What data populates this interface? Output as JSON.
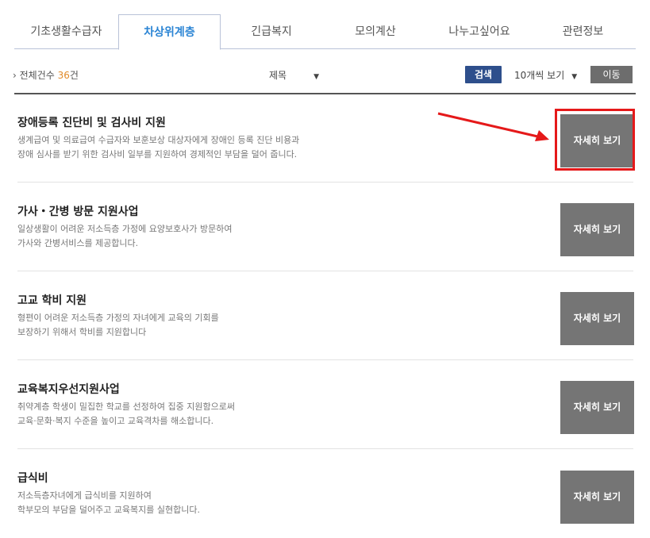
{
  "tabs": [
    {
      "label": "기초생활수급자",
      "active": false
    },
    {
      "label": "차상위계층",
      "active": true
    },
    {
      "label": "긴급복지",
      "active": false
    },
    {
      "label": "모의계산",
      "active": false
    },
    {
      "label": "나누고싶어요",
      "active": false
    },
    {
      "label": "관련정보",
      "active": false
    }
  ],
  "toolbar": {
    "total_prefix": "› 전체건수 ",
    "total_count": "36",
    "total_suffix": "건",
    "search_field": "제목",
    "search_label": "검색",
    "page_size": "10개씩 보기",
    "go_label": "이동",
    "dropdown_arrow": "▼"
  },
  "items": [
    {
      "title": "장애등록 진단비 및 검사비 지원",
      "desc1": "생계급여 및 의료급여 수급자와 보훈보상 대상자에게 장애인 등록 진단 비용과",
      "desc2": "장애 심사를 받기 위한 검사비 일부를 지원하여 경제적인 부담을 덜어 줍니다.",
      "detail_label": "자세히 보기"
    },
    {
      "title": "가사・간병 방문 지원사업",
      "desc1": "일상생활이 어려운 저소득층 가정에 요양보호사가 방문하여",
      "desc2": "가사와 간병서비스를 제공합니다.",
      "detail_label": "자세히 보기"
    },
    {
      "title": "고교 학비 지원",
      "desc1": "형편이 어려운 저소득층 가정의 자녀에게 교육의 기회를",
      "desc2": "보장하기 위해서 학비를 지원합니다",
      "detail_label": "자세히 보기"
    },
    {
      "title": "교육복지우선지원사업",
      "desc1": "취약계층 학생이 밀집한 학교를 선정하여 집중 지원함으로써",
      "desc2": "교육·문화·복지 수준을 높이고 교육격차를 해소합니다.",
      "detail_label": "자세히 보기"
    },
    {
      "title": "급식비",
      "desc1": "저소득층자녀에게 급식비를 지원하여",
      "desc2": "학부모의 부담을 덜어주고 교육복지를 실현합니다.",
      "detail_label": "자세히 보기"
    }
  ],
  "colors": {
    "accent": "#2a84d4",
    "count": "#e08a2a",
    "search_btn": "#2e4f8c",
    "detail_btn": "#757575",
    "highlight": "#e5191a"
  }
}
